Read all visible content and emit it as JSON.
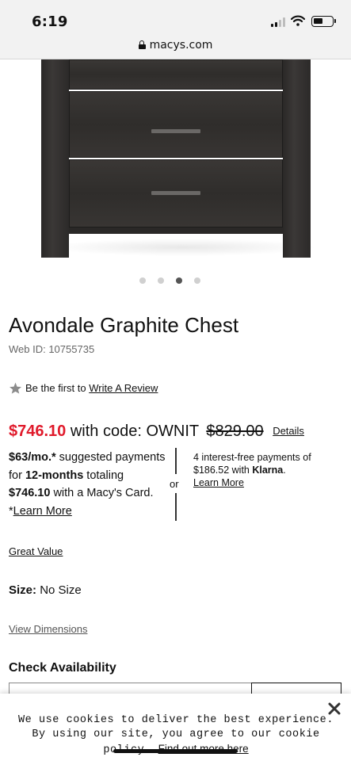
{
  "status_bar": {
    "time": "6:19"
  },
  "browser": {
    "url": "macys.com"
  },
  "carousel": {
    "dot_count": 4,
    "active_index": 2
  },
  "product": {
    "title": "Avondale Graphite Chest",
    "web_id": "Web ID: 10755735",
    "review_prefix": "Be the first to",
    "review_link": "Write A Review",
    "sale_price": "$746.10",
    "promo_text": "with code: OWNIT",
    "original_price": "$829.00",
    "details_link": "Details",
    "colors": {
      "sale_price": "#e01a2b"
    }
  },
  "financing": {
    "monthly": "$63/mo.*",
    "text_a": " suggested payments for ",
    "months": "12-months",
    "text_b": " totaling ",
    "total": "$746.10",
    "text_c": " with a Macy's Card. *",
    "learn_more": "Learn More",
    "or_label": "or",
    "klarna_text_a": "4 interest-free payments of $186.52 with ",
    "klarna_brand": "Klarna",
    "klarna_text_b": ".",
    "klarna_learn_more": "Learn More"
  },
  "badges": {
    "great_value": "Great Value"
  },
  "size": {
    "label": "Size:",
    "value": "No Size"
  },
  "dimensions_link": "View Dimensions",
  "availability": {
    "heading": "Check Availability"
  },
  "cookie_banner": {
    "text": "We use cookies to deliver the best experience. By using our site, you agree to our cookie policy.",
    "link": "Find out more here"
  },
  "icons": {
    "lock": "lock-icon",
    "star": "star-icon",
    "close": "close-icon",
    "signal": "signal-icon",
    "wifi": "wifi-icon",
    "battery": "battery-icon"
  }
}
